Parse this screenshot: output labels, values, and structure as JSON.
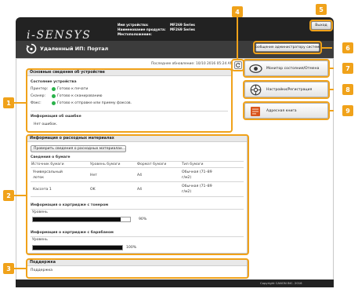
{
  "header": {
    "logo_text": "i-SENSYS",
    "device_labels": [
      "Имя устройства:",
      "Наименование продукта:",
      "Местоположение:"
    ],
    "device_values": [
      "MF269 Series",
      "MF269 Series",
      ""
    ],
    "logout_label": "Выход"
  },
  "titlebar": {
    "title": "Удаленный ИП: Портал",
    "admin_message_label": "Сообщение администратору системы"
  },
  "last_updated": "Последнее обновление: 10/10 2016 05:24 AM",
  "device_info": {
    "title": "Основные сведения об устройстве",
    "status_heading": "Состояние устройства",
    "status_rows": [
      {
        "device": "Принтер:",
        "status": "Готово к печати"
      },
      {
        "device": "Сканер:",
        "status": "Готово к сканированию"
      },
      {
        "device": "Факс:",
        "status": "Готово к отправке или приему факсов."
      }
    ],
    "error_heading": "Информация об ошибке",
    "error_text": "Нет ошибок."
  },
  "consumables": {
    "title": "Информация о расходных материалах",
    "check_button_label": "Проверить сведения о расходных материалах...",
    "paper_heading": "Сведения о бумаге",
    "paper_columns": [
      "Источник бумаги",
      "Уровень бумаги",
      "Формат бумаги",
      "Тип бумаги"
    ],
    "paper_rows": [
      {
        "source": [
          "Универсальный",
          "лоток"
        ],
        "level": "Нет",
        "size": "A4",
        "type": [
          "Обычная (71–89",
          "г/м2)"
        ]
      },
      {
        "source": [
          "Кассета 1"
        ],
        "level": "OK",
        "size": "A4",
        "type": [
          "Обычная (71–89",
          "г/м2)"
        ]
      }
    ],
    "toner_heading": "Информация о картридже с тонером",
    "toner_level_label": "Уровень",
    "toner_percent_text": "90%",
    "toner_level": 0.9,
    "drum_heading": "Информация о картридже с барабаном",
    "drum_level_label": "Уровень",
    "drum_percent_text": "100%",
    "drum_level": 1.0
  },
  "support": {
    "title": "Поддержка",
    "text": "Поддержка"
  },
  "side_menu": [
    {
      "label": "Монитор состояния/Отмена",
      "icon": "status-monitor-icon"
    },
    {
      "label": "Настройки/Регистрация",
      "icon": "settings-icon"
    },
    {
      "label": "Адресная книга",
      "icon": "address-book-icon"
    }
  ],
  "copyright": "Copyright CANON INC. 2016",
  "callouts": [
    "1",
    "2",
    "3",
    "4",
    "5",
    "6",
    "7",
    "8",
    "9"
  ],
  "colors": {
    "callout": "#f0a21a",
    "status_ok": "#2ab24a",
    "header_bg": "#222222",
    "titlebar_bg": "#3c3c3c"
  }
}
